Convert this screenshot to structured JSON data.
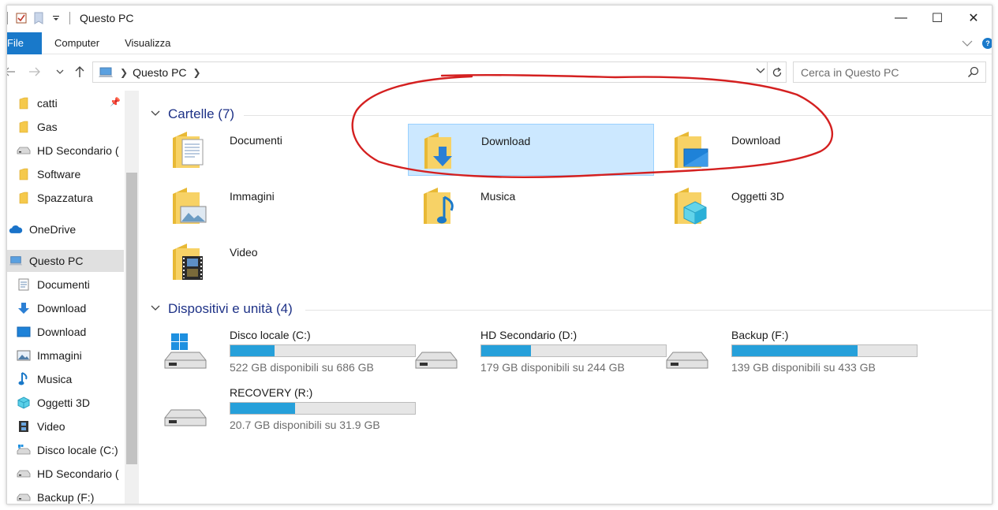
{
  "window": {
    "title": "Questo PC"
  },
  "titlebar": {
    "minimize": "—",
    "maximize": "☐",
    "close": "✕"
  },
  "ribbon": {
    "file": "File",
    "tabs": [
      "Computer",
      "Visualizza"
    ],
    "help": "?"
  },
  "address": {
    "segment": "Questo PC",
    "search_placeholder": "Cerca in Questo PC"
  },
  "sidebar": {
    "items": [
      {
        "label": "catti",
        "icon": "folder-icon"
      },
      {
        "label": "Gas",
        "icon": "folder-icon"
      },
      {
        "label": "HD Secondario (",
        "icon": "drive-icon"
      },
      {
        "label": "Software",
        "icon": "folder-icon"
      },
      {
        "label": "Spazzatura",
        "icon": "folder-icon"
      },
      {
        "label": "OneDrive",
        "icon": "cloud-icon"
      },
      {
        "label": "Questo PC",
        "icon": "computer-icon"
      },
      {
        "label": "Documenti",
        "icon": "document-icon"
      },
      {
        "label": "Download",
        "icon": "download-icon"
      },
      {
        "label": "Download",
        "icon": "desktop-icon"
      },
      {
        "label": "Immagini",
        "icon": "picture-icon"
      },
      {
        "label": "Musica",
        "icon": "music-icon"
      },
      {
        "label": "Oggetti 3D",
        "icon": "cube-icon"
      },
      {
        "label": "Video",
        "icon": "film-icon"
      },
      {
        "label": "Disco locale (C:)",
        "icon": "windows-drive-icon"
      },
      {
        "label": "HD Secondario (",
        "icon": "drive-icon"
      },
      {
        "label": "Backup (F:)",
        "icon": "drive-icon"
      }
    ]
  },
  "groups": {
    "folders_header": "Cartelle (7)",
    "devices_header": "Dispositivi e unità (4)"
  },
  "folders": [
    {
      "label": "Documenti",
      "icon": "documents-folder-icon"
    },
    {
      "label": "Download",
      "icon": "download-folder-icon"
    },
    {
      "label": "Download",
      "icon": "desktop-folder-icon"
    },
    {
      "label": "Immagini",
      "icon": "pictures-folder-icon"
    },
    {
      "label": "Musica",
      "icon": "music-folder-icon"
    },
    {
      "label": "Oggetti 3D",
      "icon": "objects-3d-folder-icon"
    },
    {
      "label": "Video",
      "icon": "video-folder-icon"
    }
  ],
  "drives": [
    {
      "name": "Disco locale (C:)",
      "info": "522 GB disponibili su 686 GB",
      "used_fraction": 0.24,
      "icon": "windows-drive-icon"
    },
    {
      "name": "HD Secondario (D:)",
      "info": "179 GB disponibili su 244 GB",
      "used_fraction": 0.27,
      "icon": "drive-icon"
    },
    {
      "name": "Backup (F:)",
      "info": "139 GB disponibili su 433 GB",
      "used_fraction": 0.68,
      "icon": "drive-icon"
    },
    {
      "name": "RECOVERY (R:)",
      "info": "20.7 GB disponibili su 31.9 GB",
      "used_fraction": 0.35,
      "icon": "drive-icon"
    }
  ],
  "colors": {
    "accent": "#1979ca",
    "selection": "#cce8ff",
    "bar": "#26a0da",
    "header": "#1e3287",
    "annotation": "#d42020"
  }
}
